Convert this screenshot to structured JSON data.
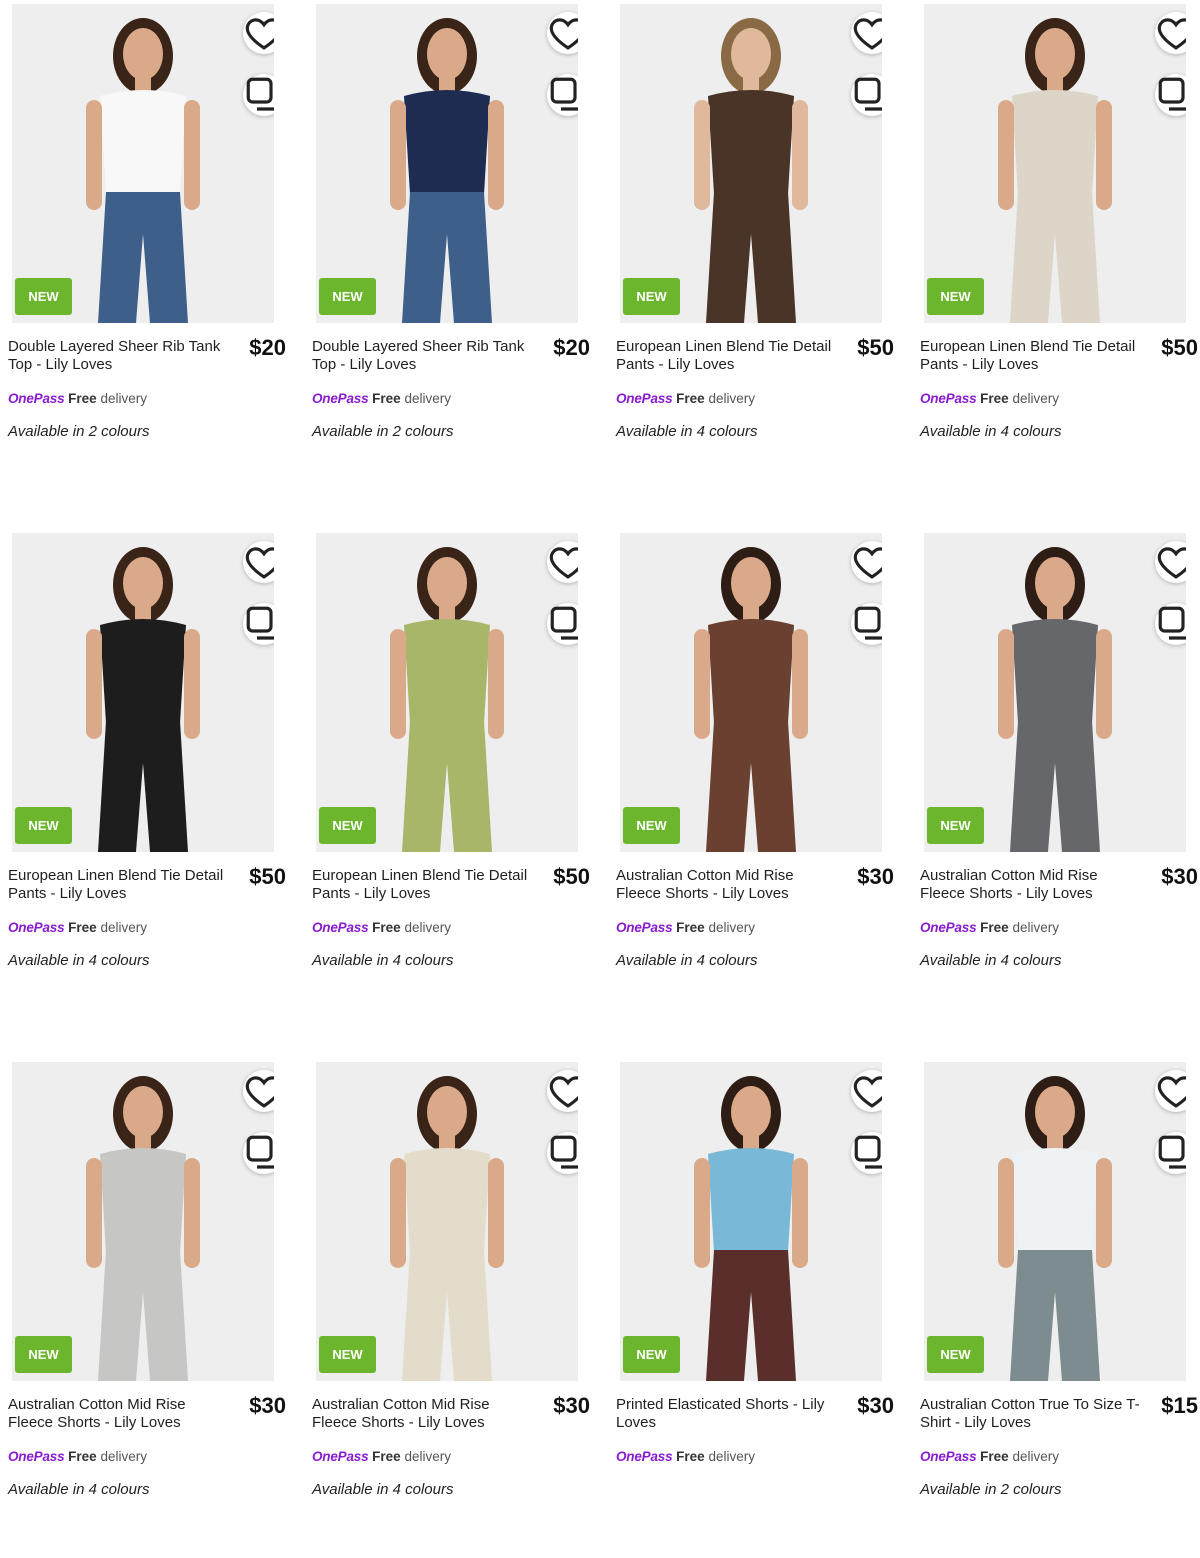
{
  "colors": {
    "badge": "#6cb62e",
    "onepass": "#8a1bd0"
  },
  "products": [
    {
      "title": "Double Layered Sheer Rib Tank Top - Lily Loves",
      "price": "$20",
      "badge": "NEW",
      "brand_tag": "OnePass",
      "free": "Free",
      "delivery": "delivery",
      "colours": "Available in 2 colours",
      "image_colors": {
        "top": "#f8f8f8",
        "bottom": "#3e5f8a",
        "skin": "#d9a98a",
        "hair": "#3a2418"
      }
    },
    {
      "title": "Double Layered Sheer Rib Tank Top - Lily Loves",
      "price": "$20",
      "badge": "NEW",
      "brand_tag": "OnePass",
      "free": "Free",
      "delivery": "delivery",
      "colours": "Available in 2 colours",
      "image_colors": {
        "top": "#1f2c52",
        "bottom": "#3e5f8a",
        "skin": "#d9a98a",
        "hair": "#3a2418"
      }
    },
    {
      "title": "European Linen Blend Tie Detail Pants - Lily Loves",
      "price": "$50",
      "badge": "NEW",
      "brand_tag": "OnePass",
      "free": "Free",
      "delivery": "delivery",
      "colours": "Available in 4 colours",
      "image_colors": {
        "top": "#4a3427",
        "bottom": "#4a3427",
        "skin": "#e0b89c",
        "hair": "#8a6a44"
      }
    },
    {
      "title": "European Linen Blend Tie Detail Pants - Lily Loves",
      "price": "$50",
      "badge": "NEW",
      "brand_tag": "OnePass",
      "free": "Free",
      "delivery": "delivery",
      "colours": "Available in 4 colours",
      "image_colors": {
        "top": "#ddd6c8",
        "bottom": "#ddd6c8",
        "skin": "#d9a98a",
        "hair": "#3a2418"
      }
    },
    {
      "title": "European Linen Blend Tie Detail Pants - Lily Loves",
      "price": "$50",
      "badge": "NEW",
      "brand_tag": "OnePass",
      "free": "Free",
      "delivery": "delivery",
      "colours": "Available in 4 colours",
      "image_colors": {
        "top": "#1d1d1d",
        "bottom": "#1d1d1d",
        "skin": "#d9a98a",
        "hair": "#3a2418"
      }
    },
    {
      "title": "European Linen Blend Tie Detail Pants - Lily Loves",
      "price": "$50",
      "badge": "NEW",
      "brand_tag": "OnePass",
      "free": "Free",
      "delivery": "delivery",
      "colours": "Available in 4 colours",
      "image_colors": {
        "top": "#a8b66a",
        "bottom": "#a8b66a",
        "skin": "#d9a98a",
        "hair": "#3a2418"
      }
    },
    {
      "title": "Australian Cotton Mid Rise Fleece Shorts - Lily Loves",
      "price": "$30",
      "badge": "NEW",
      "brand_tag": "OnePass",
      "free": "Free",
      "delivery": "delivery",
      "colours": "Available in 4 colours",
      "image_colors": {
        "top": "#6a4030",
        "bottom": "#6a4030",
        "skin": "#d9a98a",
        "hair": "#2e1d14"
      }
    },
    {
      "title": "Australian Cotton Mid Rise Fleece Shorts - Lily Loves",
      "price": "$30",
      "badge": "NEW",
      "brand_tag": "OnePass",
      "free": "Free",
      "delivery": "delivery",
      "colours": "Available in 4 colours",
      "image_colors": {
        "top": "#66676a",
        "bottom": "#66676a",
        "skin": "#d9a98a",
        "hair": "#2e1d14"
      }
    },
    {
      "title": "Australian Cotton Mid Rise Fleece Shorts - Lily Loves",
      "price": "$30",
      "badge": "NEW",
      "brand_tag": "OnePass",
      "free": "Free",
      "delivery": "delivery",
      "colours": "Available in 4 colours",
      "image_colors": {
        "top": "#c6c6c4",
        "bottom": "#c6c6c4",
        "skin": "#d9a98a",
        "hair": "#3a2418"
      }
    },
    {
      "title": "Australian Cotton Mid Rise Fleece Shorts - Lily Loves",
      "price": "$30",
      "badge": "NEW",
      "brand_tag": "OnePass",
      "free": "Free",
      "delivery": "delivery",
      "colours": "Available in 4 colours",
      "image_colors": {
        "top": "#e4dccb",
        "bottom": "#e4dccb",
        "skin": "#d9a98a",
        "hair": "#3a2418"
      }
    },
    {
      "title": "Printed Elasticated Shorts - Lily Loves",
      "price": "$30",
      "badge": "NEW",
      "brand_tag": "OnePass",
      "free": "Free",
      "delivery": "delivery",
      "colours": "",
      "image_colors": {
        "top": "#7ab8d8",
        "bottom": "#5a2e2a",
        "skin": "#d9a98a",
        "hair": "#2e1d14"
      }
    },
    {
      "title": "Australian Cotton True To Size T-Shirt - Lily Loves",
      "price": "$15",
      "badge": "NEW",
      "brand_tag": "OnePass",
      "free": "Free",
      "delivery": "delivery",
      "colours": "Available in 2 colours",
      "image_colors": {
        "top": "#eef2f4",
        "bottom": "#7d8c8e",
        "skin": "#d9a98a",
        "hair": "#2e1d14"
      }
    }
  ]
}
